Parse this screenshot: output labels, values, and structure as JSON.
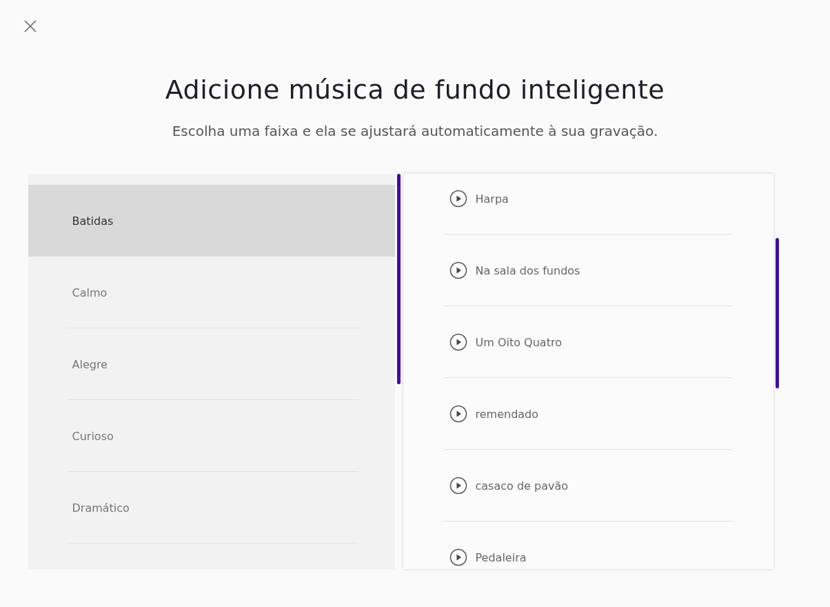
{
  "title": "Adicione música de fundo inteligente",
  "subtitle": "Escolha uma faixa e ela se ajustará automaticamente à sua gravação.",
  "categories": [
    {
      "label": "Batidas",
      "selected": true
    },
    {
      "label": "Calmo",
      "selected": false
    },
    {
      "label": "Alegre",
      "selected": false
    },
    {
      "label": "Curioso",
      "selected": false
    },
    {
      "label": "Dramático",
      "selected": false
    }
  ],
  "tracks": [
    {
      "label": "Harpa"
    },
    {
      "label": "Na sala dos fundos"
    },
    {
      "label": "Um Oito Quatro"
    },
    {
      "label": "remendado"
    },
    {
      "label": "casaco de pavão"
    },
    {
      "label": "Pedaleira"
    }
  ]
}
